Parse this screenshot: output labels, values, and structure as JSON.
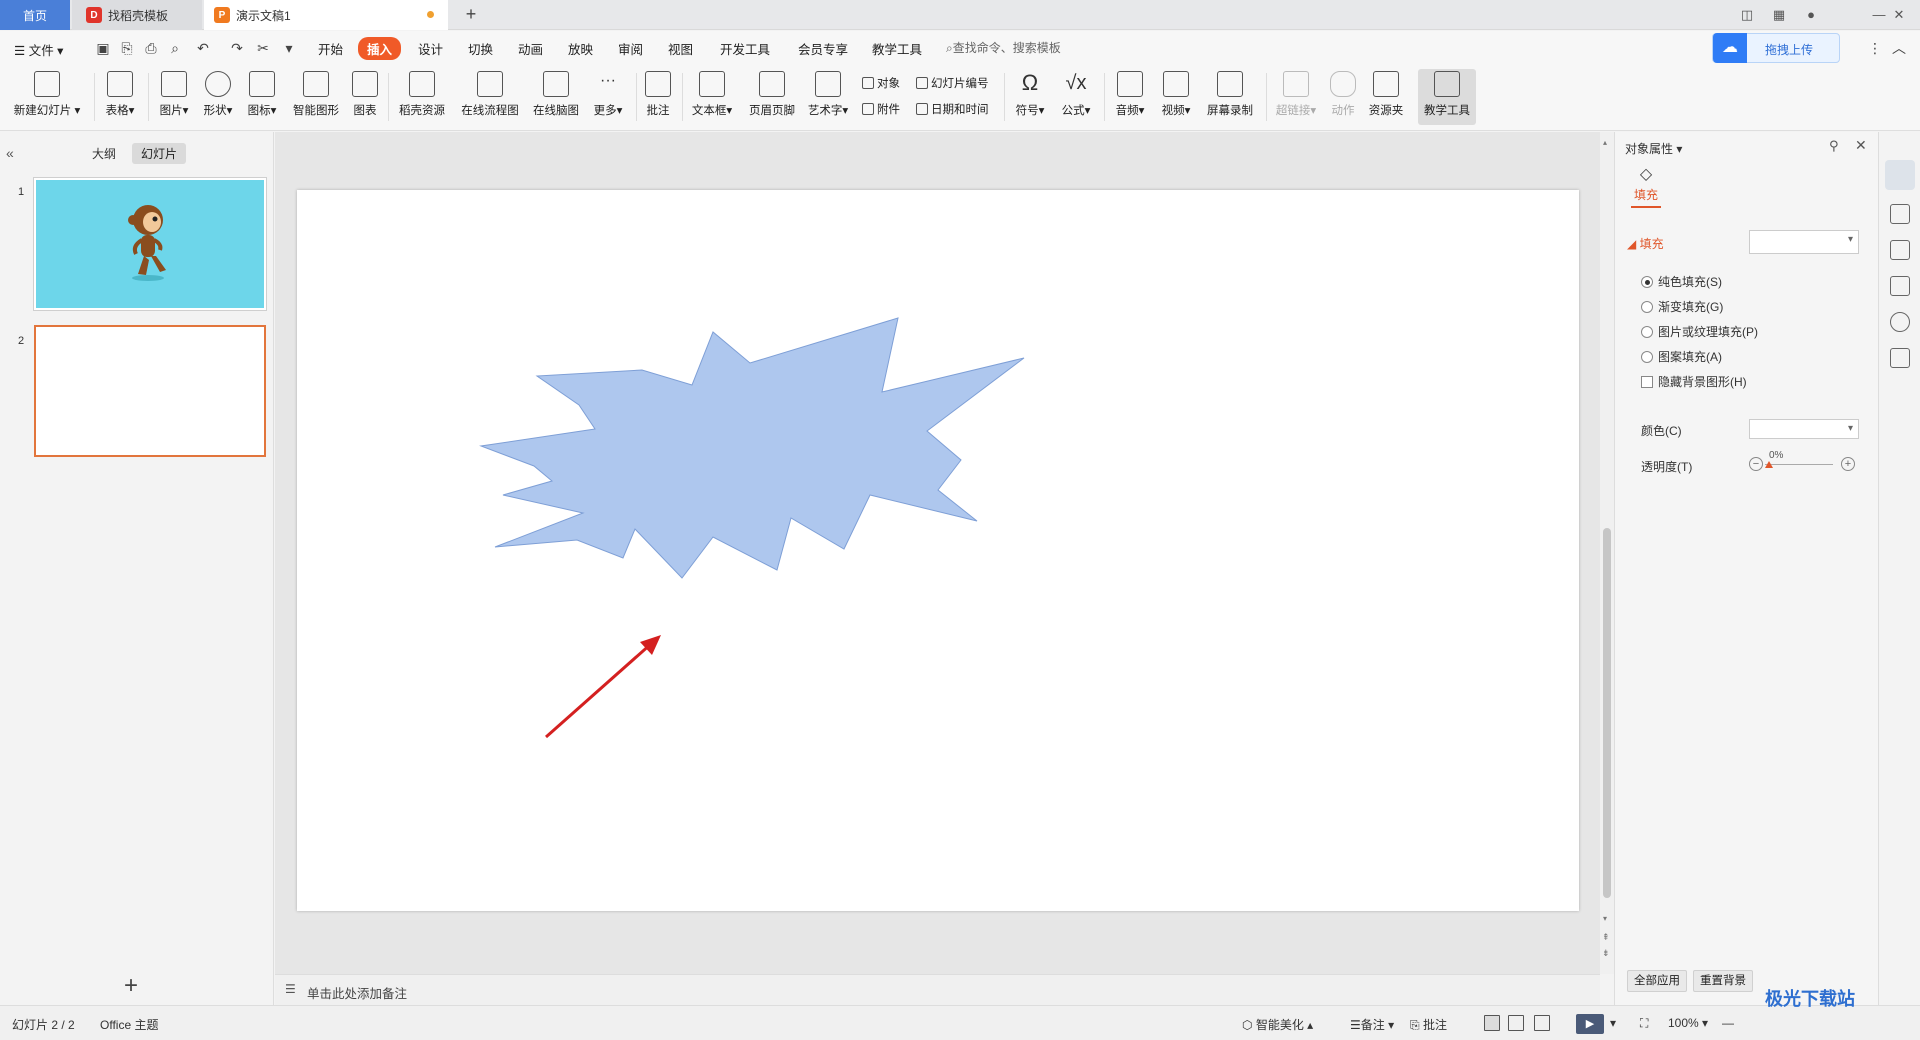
{
  "tabs": {
    "home": "首页",
    "template": "找稻壳模板",
    "document": "演示文稿1",
    "add": "+"
  },
  "menu": {
    "file": "文件",
    "items": [
      "开始",
      "插入",
      "设计",
      "切换",
      "动画",
      "放映",
      "审阅",
      "视图",
      "开发工具",
      "会员专享",
      "教学工具"
    ],
    "search_placeholder": "查找命令、搜索模板",
    "upload": "拖拽上传"
  },
  "ribbon": {
    "new_slide": "新建幻灯片",
    "table": "表格",
    "image": "图片",
    "shape": "形状",
    "icon": "图标",
    "smart_graphic": "智能图形",
    "chart": "图表",
    "docer_resource": "稻壳资源",
    "online_flowchart": "在线流程图",
    "online_mindmap": "在线脑图",
    "more": "更多",
    "comment": "批注",
    "textbox": "文本框",
    "header_footer": "页眉页脚",
    "word_art": "艺术字",
    "object": "对象",
    "attachment": "附件",
    "slide_number": "幻灯片编号",
    "datetime": "日期和时间",
    "symbol": "符号",
    "formula": "公式",
    "audio": "音频",
    "video": "视频",
    "screen_record": "屏幕录制",
    "hyperlink": "超链接",
    "action": "动作",
    "resource_folder": "资源夹",
    "teaching_tools": "教学工具"
  },
  "left_panel": {
    "outline": "大纲",
    "slides": "幻灯片",
    "thumb_numbers": [
      "1",
      "2"
    ],
    "add": "+"
  },
  "notes": {
    "placeholder": "单击此处添加备注"
  },
  "right_panel": {
    "title": "对象属性",
    "fill_tab": "填充",
    "fill_section": "填充",
    "options": [
      "纯色填充(S)",
      "渐变填充(G)",
      "图片或纹理填充(P)",
      "图案填充(A)"
    ],
    "selected_option": 0,
    "hide_bg": "隐藏背景图形(H)",
    "color_label": "颜色(C)",
    "transparency_label": "透明度(T)",
    "transparency_value": "0%",
    "apply_all": "全部应用",
    "reset_bg": "重置背景"
  },
  "status": {
    "slide_info": "幻灯片 2 / 2",
    "theme": "Office 主题",
    "beautify": "智能美化",
    "notes": "备注",
    "comment": "批注",
    "zoom": "100%"
  },
  "watermark": "极光下载站",
  "colors": {
    "accent": "#f05a28",
    "shape_fill": "#aec7ee",
    "shape_stroke": "#7e9fd6",
    "arrow": "#d42020",
    "thumb_bg": "#6dd6ea"
  }
}
